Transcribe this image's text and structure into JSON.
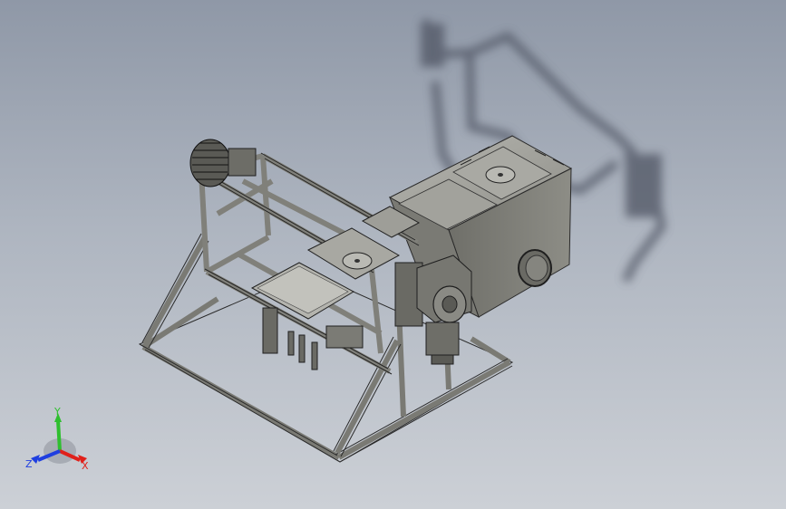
{
  "viewport": {
    "background_top": "#8f98a7",
    "background_bottom": "#ccd0d6"
  },
  "model": {
    "frame_color": "#7d7d77",
    "frame_edge": "#2b2b2b",
    "enclosure_color": "#8a8a84",
    "shadow_color": "#5c6270"
  },
  "triad": {
    "x_label": "X",
    "y_label": "Y",
    "z_label": "Z",
    "x_color": "#e0201a",
    "y_color": "#2fbf2f",
    "z_color": "#1f3fe0"
  }
}
